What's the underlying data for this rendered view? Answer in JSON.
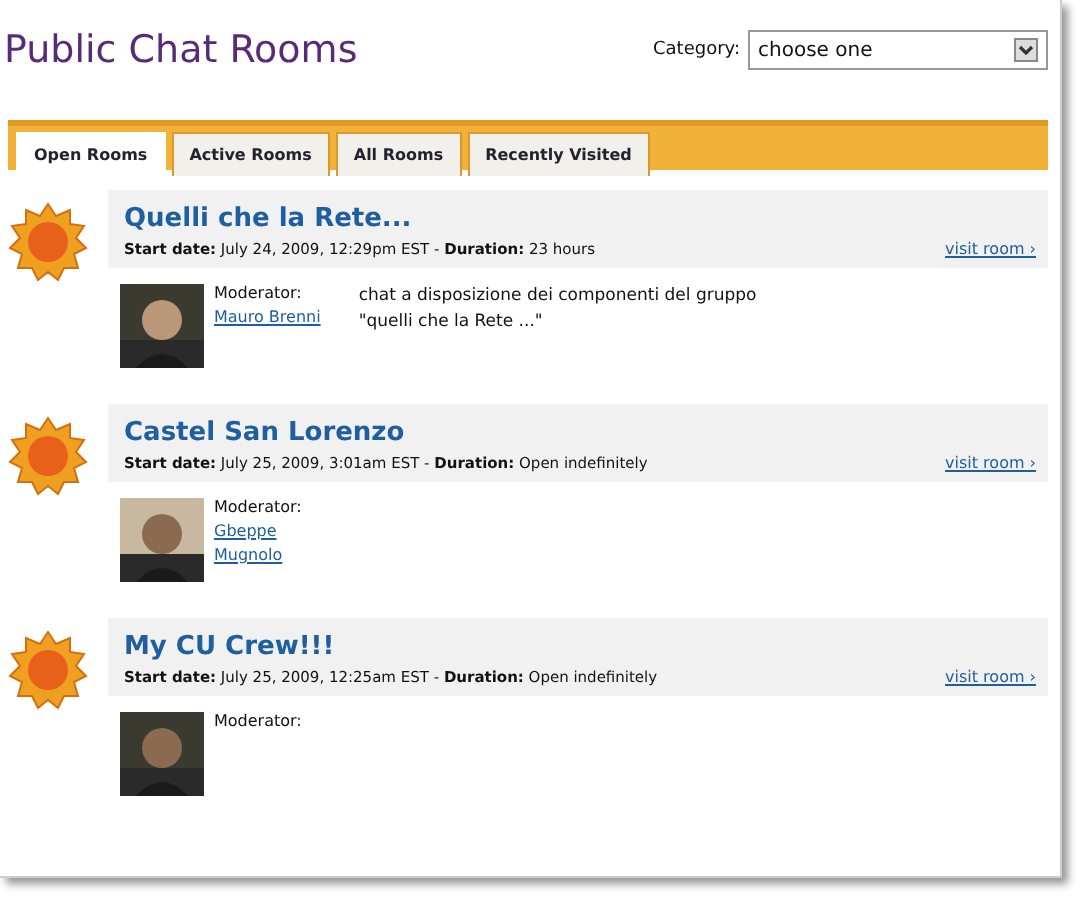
{
  "title": "Public Chat Rooms",
  "category": {
    "label": "Category:",
    "value": "choose one"
  },
  "tabs": [
    {
      "label": "Open Rooms",
      "selected": true
    },
    {
      "label": "Active Rooms",
      "selected": false
    },
    {
      "label": "All Rooms",
      "selected": false
    },
    {
      "label": "Recently Visited",
      "selected": false
    }
  ],
  "rooms": [
    {
      "name": "Quelli che la Rete...",
      "meta": "**Start date:** July 24, 2009, 12:29pm EST - **Duration:** 23 hours",
      "visit": "visit room ›",
      "moderator_label": "Moderator:",
      "moderators": [
        "Mauro Brenni"
      ],
      "description": "chat a disposizione dei componenti del gruppo \"quelli che la Rete ...\""
    },
    {
      "name": "Castel San Lorenzo",
      "meta": "**Start date:** July 25, 2009, 3:01am EST - **Duration:** Open indefinitely",
      "visit": "visit room ›",
      "moderator_label": "Moderator:",
      "moderators": [
        "Gbeppe",
        "Mugnolo"
      ]
    },
    {
      "name": "My CU Crew!!!",
      "meta": "**Start date:** July 25, 2009, 12:25am EST - **Duration:** Open indefinitely",
      "visit": "visit room ›",
      "moderator_label": "Moderator:"
    }
  ]
}
